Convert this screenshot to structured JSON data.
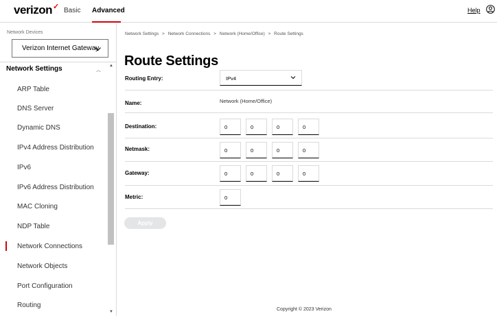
{
  "brand": {
    "logo_text": "verizon",
    "logo_mark": "✓",
    "accent": "#cd040b"
  },
  "header": {
    "tabs": [
      {
        "label": "Basic"
      },
      {
        "label": "Advanced",
        "active": true
      }
    ],
    "help_label": "Help",
    "user_icon": "user-circle-icon"
  },
  "sidebar": {
    "devices_label": "Network Devices",
    "device_selected": "Verizon Internet Gateway",
    "section_label": "Network Settings",
    "items": [
      {
        "label": "ARP Table"
      },
      {
        "label": "DNS Server"
      },
      {
        "label": "Dynamic DNS"
      },
      {
        "label": "IPv4 Address Distribution"
      },
      {
        "label": "IPv6"
      },
      {
        "label": "IPv6 Address Distribution"
      },
      {
        "label": "MAC Cloning"
      },
      {
        "label": "NDP Table"
      },
      {
        "label": "Network Connections",
        "active": true
      },
      {
        "label": "Network Objects"
      },
      {
        "label": "Port Configuration"
      },
      {
        "label": "Routing"
      }
    ]
  },
  "breadcrumb": [
    "Network Settings",
    ">",
    "Network Connections",
    ">",
    "Network (Home/Office)",
    ">",
    "Route Settings"
  ],
  "page_title": "Route Settings",
  "form": {
    "routing_entry": {
      "label": "Routing Entry:",
      "value": "IPv4"
    },
    "name": {
      "label": "Name:",
      "value": "Network (Home/Office)"
    },
    "destination": {
      "label": "Destination:",
      "octets": [
        "0",
        "0",
        "0",
        "0"
      ]
    },
    "netmask": {
      "label": "Netmask:",
      "octets": [
        "0",
        "0",
        "0",
        "0"
      ]
    },
    "gateway": {
      "label": "Gateway:",
      "octets": [
        "0",
        "0",
        "0",
        "0"
      ]
    },
    "metric": {
      "label": "Metric:",
      "value": "0"
    },
    "apply_label": "Apply"
  },
  "footer": {
    "copyright": "Copyright © 2023 Verizon"
  }
}
